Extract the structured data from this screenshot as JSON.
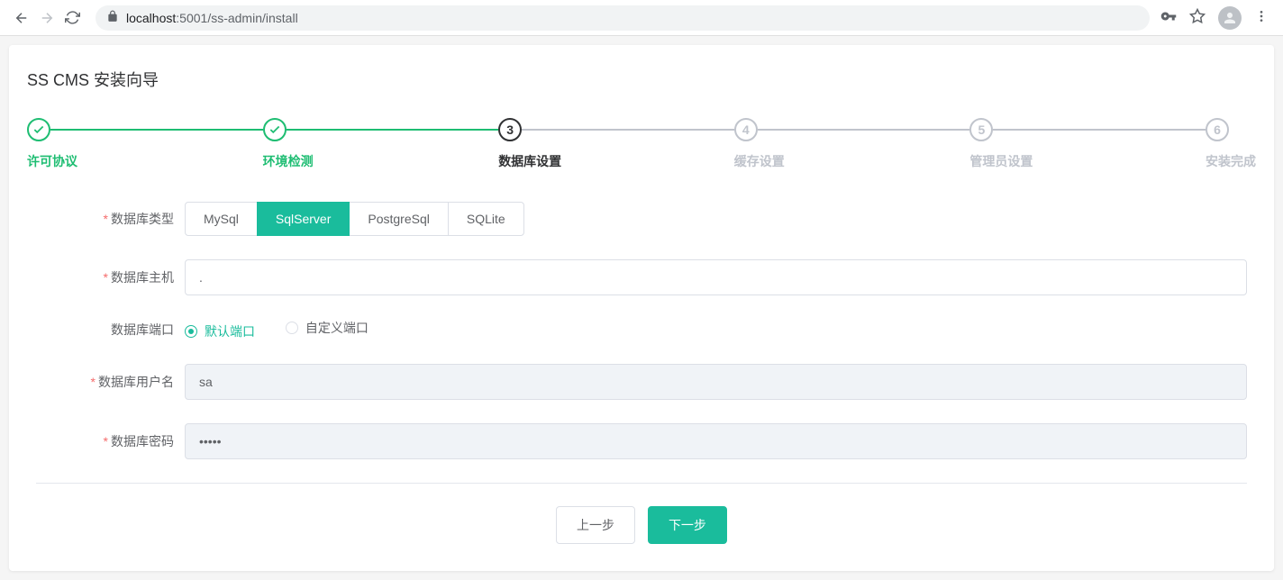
{
  "browser": {
    "url_host": "localhost",
    "url_port": ":5001",
    "url_path": "/ss-admin/install"
  },
  "page": {
    "title": "SS CMS 安装向导"
  },
  "steps": [
    {
      "label": "许可协议",
      "state": "done"
    },
    {
      "label": "环境检测",
      "state": "done"
    },
    {
      "label": "数据库设置",
      "state": "active",
      "num": "3"
    },
    {
      "label": "缓存设置",
      "state": "pending",
      "num": "4"
    },
    {
      "label": "管理员设置",
      "state": "pending",
      "num": "5"
    },
    {
      "label": "安装完成",
      "state": "pending",
      "num": "6"
    }
  ],
  "form": {
    "db_type": {
      "label": "数据库类型",
      "options": [
        "MySql",
        "SqlServer",
        "PostgreSql",
        "SQLite"
      ],
      "selected": "SqlServer"
    },
    "db_host": {
      "label": "数据库主机",
      "value": "."
    },
    "db_port": {
      "label": "数据库端口",
      "options": [
        "默认端口",
        "自定义端口"
      ],
      "selected": "默认端口"
    },
    "db_user": {
      "label": "数据库用户名",
      "value": "sa"
    },
    "db_password": {
      "label": "数据库密码",
      "value": "•••••"
    }
  },
  "buttons": {
    "prev": "上一步",
    "next": "下一步"
  }
}
